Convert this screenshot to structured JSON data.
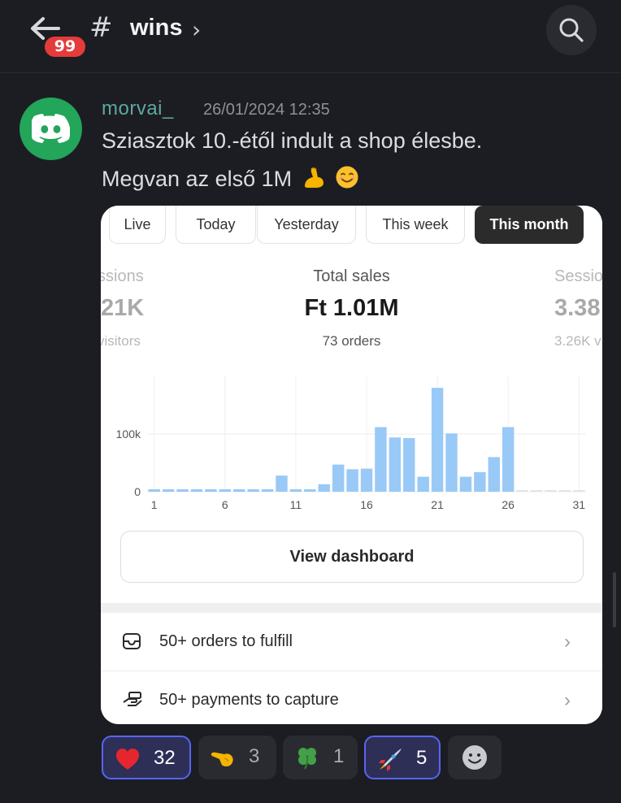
{
  "header": {
    "unread_badge": "99",
    "hash": "#",
    "channel_name": "wins",
    "chevron": "›"
  },
  "message": {
    "username": "morvai_",
    "timestamp": "26/01/2024 12:35",
    "line1": "Sziasztok 10.-étől indult a shop élesbe.",
    "line2": "Megvan az első 1M"
  },
  "card": {
    "tabs": [
      "Live",
      "Today",
      "Yesterday",
      "This week",
      "This month"
    ],
    "active_tab": "This month",
    "metrics": {
      "left_label": "ssions",
      "left_value": "21K",
      "left_sub": "visitors",
      "center_label": "Total sales",
      "center_value": "Ft 1.01M",
      "center_sub": "73 orders",
      "right_label": "Sessio",
      "right_value": "3.38",
      "right_sub": "3.26K v"
    },
    "view_dashboard": "View dashboard",
    "rows": [
      {
        "label": "50+ orders to fulfill",
        "icon": "inbox-icon"
      },
      {
        "label": "50+ payments to capture",
        "icon": "hand-payment-icon"
      }
    ],
    "row_chevron": "›"
  },
  "chart_data": {
    "type": "bar",
    "x": [
      1,
      2,
      3,
      4,
      5,
      6,
      7,
      8,
      9,
      10,
      11,
      12,
      13,
      14,
      15,
      16,
      17,
      18,
      19,
      20,
      21,
      22,
      23,
      24,
      25,
      26,
      27,
      28,
      29,
      30,
      31
    ],
    "values": [
      2000,
      2000,
      2000,
      2000,
      2000,
      2000,
      2000,
      2000,
      2000,
      28000,
      2000,
      2000,
      13000,
      47000,
      39000,
      40000,
      112000,
      94000,
      93000,
      26000,
      180000,
      101000,
      26000,
      34000,
      60000,
      112000,
      0,
      0,
      0,
      0,
      0
    ],
    "xticks": [
      "1",
      "6",
      "11",
      "16",
      "21",
      "26",
      "31"
    ],
    "yticks": [
      "0",
      "100k"
    ],
    "ylim": [
      0,
      200000
    ],
    "color": "#99c9f6",
    "grid": true
  },
  "reactions": [
    {
      "emoji": "heart-emoji",
      "count": "32",
      "me": true
    },
    {
      "emoji": "pointing-hand-emoji",
      "count": "3",
      "me": false
    },
    {
      "emoji": "four-leaf-clover-emoji",
      "count": "1",
      "me": false
    },
    {
      "emoji": "rocket-emoji",
      "count": "5",
      "me": true
    }
  ],
  "colors": {
    "background": "#1c1d22",
    "username": "#5fa7a1",
    "badge": "#e43b3b",
    "avatar": "#23a55a",
    "reaction_selected_border": "#5865f2"
  }
}
